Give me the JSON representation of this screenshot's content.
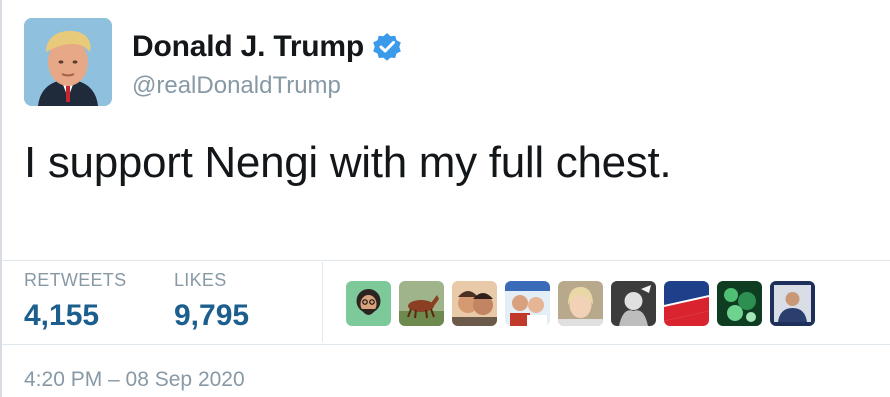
{
  "author": {
    "display_name": "Donald J. Trump",
    "handle": "@realDonaldTrump",
    "verified": true,
    "verified_color": "#3b9bea",
    "avatar_icon": "profile-photo-icon"
  },
  "tweet": {
    "text": "I support Nengi with my full chest."
  },
  "stats": {
    "retweets_label": "RETWEETS",
    "retweets_value": "4,155",
    "likes_label": "LIKES",
    "likes_value": "9,795",
    "value_color": "#1c5e8e"
  },
  "liked_by": [
    {
      "icon": "liker-avatar-icon"
    },
    {
      "icon": "liker-avatar-icon"
    },
    {
      "icon": "liker-avatar-icon"
    },
    {
      "icon": "liker-avatar-icon"
    },
    {
      "icon": "liker-avatar-icon"
    },
    {
      "icon": "liker-avatar-icon"
    },
    {
      "icon": "liker-avatar-icon"
    },
    {
      "icon": "liker-avatar-icon"
    },
    {
      "icon": "liker-avatar-icon"
    },
    {
      "icon": "liker-avatar-icon"
    }
  ],
  "meta": {
    "timestamp": "4:20 PM – 08 Sep 2020"
  }
}
